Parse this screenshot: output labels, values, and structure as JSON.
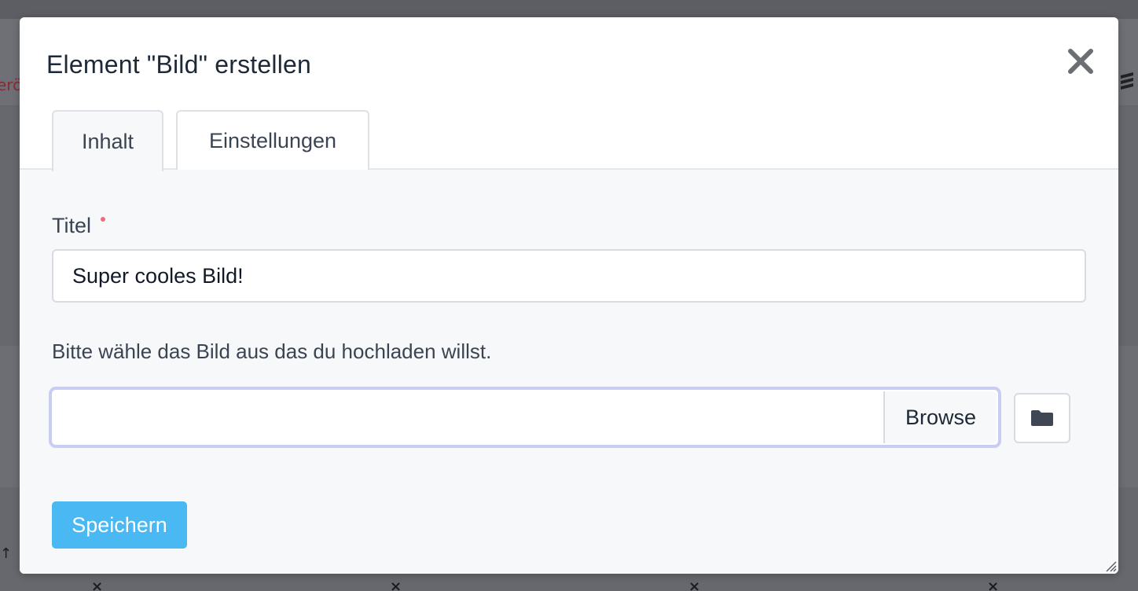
{
  "background": {
    "header_text_fragment": "erö",
    "close_glyph": "×",
    "up_arrow_glyph": "↑"
  },
  "modal": {
    "title": "Element \"Bild\" erstellen",
    "close_icon": "close-icon",
    "tabs": [
      {
        "label": "Inhalt",
        "active": true
      },
      {
        "label": "Einstellungen",
        "active": false
      }
    ],
    "form": {
      "title_label": "Titel",
      "title_required": true,
      "title_value": "Super cooles Bild!",
      "file_help_text": "Bitte wähle das Bild aus das du hochladen willst.",
      "file_value": "",
      "browse_label": "Browse",
      "folder_icon": "folder-icon"
    },
    "save_label": "Speichern"
  },
  "colors": {
    "primary_button": "#4ab8f2",
    "required_marker": "#f26b7a",
    "focus_ring": "#c9cdf3"
  }
}
